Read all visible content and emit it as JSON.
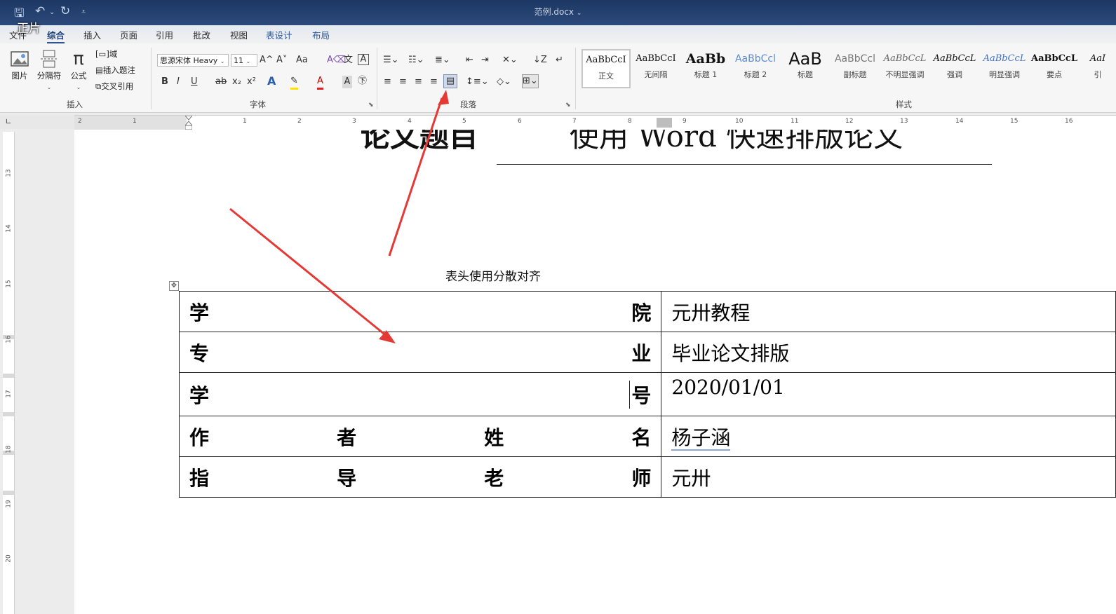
{
  "window": {
    "title": "范例.docx",
    "title_suffix": "⌄"
  },
  "overlay_label": "正片",
  "tabs": [
    "文件",
    "综合",
    "插入",
    "页面",
    "引用",
    "批改",
    "视图",
    "表设计",
    "布局"
  ],
  "ribbon": {
    "insert_group": {
      "label": "插入",
      "picture": "图片",
      "separator": "分隔符",
      "formula": "公式",
      "field": "域",
      "insert_caption": "插入题注",
      "cross_ref": "交叉引用"
    },
    "font_group": {
      "label": "字体",
      "font_name": "思源宋体 Heavy",
      "font_size": "11",
      "grow": "A^",
      "shrink": "A˅",
      "case": "Aa",
      "bold": "B",
      "italic": "I",
      "underline": "U",
      "strike": "ab",
      "subscript": "x₂",
      "superscript": "x²"
    },
    "paragraph_group": {
      "label": "段落"
    },
    "styles_group": {
      "label": "样式",
      "styles": [
        {
          "sample": "AaBbCcI",
          "name": "正文"
        },
        {
          "sample": "AaBbCcI",
          "name": "无间隔"
        },
        {
          "sample": "AaBb",
          "name": "标题 1"
        },
        {
          "sample": "AaBbCcl",
          "name": "标题 2"
        },
        {
          "sample": "AaB",
          "name": "标题"
        },
        {
          "sample": "AaBbCcl",
          "name": "副标题"
        },
        {
          "sample": "AaBbCcL",
          "name": "不明显强调"
        },
        {
          "sample": "AaBbCcL",
          "name": "强调"
        },
        {
          "sample": "AaBbCcL",
          "name": "明显强调"
        },
        {
          "sample": "AaBbCcL",
          "name": "要点"
        },
        {
          "sample": "AaI",
          "name": "引"
        }
      ]
    }
  },
  "ruler": {
    "h_numbers": [
      "2",
      "1",
      "1",
      "2",
      "3",
      "4",
      "5",
      "6",
      "7",
      "8",
      "9",
      "10",
      "11",
      "12",
      "13",
      "14",
      "15",
      "16"
    ],
    "v_numbers": [
      "13",
      "14",
      "15",
      "16",
      "17",
      "18",
      "19",
      "20"
    ]
  },
  "document": {
    "heading_label": "论文题目",
    "heading_value": "使用 Word 快速排版论文",
    "annotation": "表头使用分散对齐",
    "table": [
      {
        "label": [
          "学",
          "院"
        ],
        "value": "元卅教程"
      },
      {
        "label": [
          "专",
          "业"
        ],
        "value": "毕业论文排版"
      },
      {
        "label": [
          "学",
          "号"
        ],
        "value": "2020/01/01"
      },
      {
        "label": [
          "作",
          "者",
          "姓",
          "名"
        ],
        "value": "杨子涵"
      },
      {
        "label": [
          "指",
          "导",
          "老",
          "师"
        ],
        "value": "元卅"
      }
    ]
  },
  "colors": {
    "titlebar": "#1c3763",
    "arrow": "#e53935",
    "accent": "#2b579a"
  }
}
